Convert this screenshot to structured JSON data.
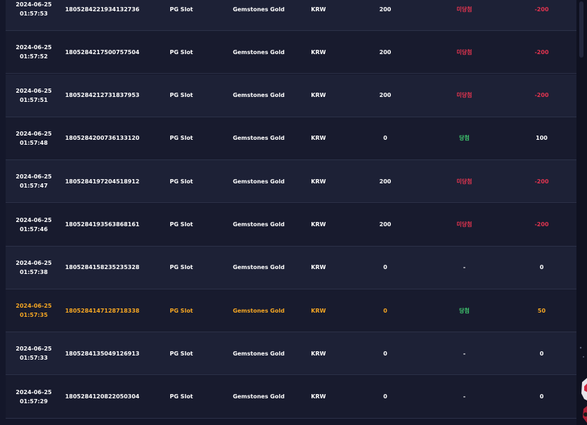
{
  "rows": [
    {
      "date": "2024-06-25",
      "time": "01:57:53",
      "id": "1805284221934132736",
      "provider": "PG Slot",
      "game": "Gemstones Gold",
      "currency": "KRW",
      "bet": "200",
      "result": "미당첨",
      "result_type": "lose",
      "pl": "-200",
      "highlight": false
    },
    {
      "date": "2024-06-25",
      "time": "01:57:52",
      "id": "1805284217500757504",
      "provider": "PG Slot",
      "game": "Gemstones Gold",
      "currency": "KRW",
      "bet": "200",
      "result": "미당첨",
      "result_type": "lose",
      "pl": "-200",
      "highlight": false
    },
    {
      "date": "2024-06-25",
      "time": "01:57:51",
      "id": "1805284212731837953",
      "provider": "PG Slot",
      "game": "Gemstones Gold",
      "currency": "KRW",
      "bet": "200",
      "result": "미당첨",
      "result_type": "lose",
      "pl": "-200",
      "highlight": false
    },
    {
      "date": "2024-06-25",
      "time": "01:57:48",
      "id": "1805284200736133120",
      "provider": "PG Slot",
      "game": "Gemstones Gold",
      "currency": "KRW",
      "bet": "0",
      "result": "당첨",
      "result_type": "win",
      "pl": "100",
      "highlight": false
    },
    {
      "date": "2024-06-25",
      "time": "01:57:47",
      "id": "1805284197204518912",
      "provider": "PG Slot",
      "game": "Gemstones Gold",
      "currency": "KRW",
      "bet": "200",
      "result": "미당첨",
      "result_type": "lose",
      "pl": "-200",
      "highlight": false
    },
    {
      "date": "2024-06-25",
      "time": "01:57:46",
      "id": "1805284193563868161",
      "provider": "PG Slot",
      "game": "Gemstones Gold",
      "currency": "KRW",
      "bet": "200",
      "result": "미당첨",
      "result_type": "lose",
      "pl": "-200",
      "highlight": false
    },
    {
      "date": "2024-06-25",
      "time": "01:57:38",
      "id": "1805284158235235328",
      "provider": "PG Slot",
      "game": "Gemstones Gold",
      "currency": "KRW",
      "bet": "0",
      "result": "-",
      "result_type": "none",
      "pl": "0",
      "highlight": false
    },
    {
      "date": "2024-06-25",
      "time": "01:57:35",
      "id": "1805284147128718338",
      "provider": "PG Slot",
      "game": "Gemstones Gold",
      "currency": "KRW",
      "bet": "0",
      "result": "당첨",
      "result_type": "win",
      "pl": "50",
      "highlight": true
    },
    {
      "date": "2024-06-25",
      "time": "01:57:33",
      "id": "1805284135049126913",
      "provider": "PG Slot",
      "game": "Gemstones Gold",
      "currency": "KRW",
      "bet": "0",
      "result": "-",
      "result_type": "none",
      "pl": "0",
      "highlight": false
    },
    {
      "date": "2024-06-25",
      "time": "01:57:29",
      "id": "1805284120822050304",
      "provider": "PG Slot",
      "game": "Gemstones Gold",
      "currency": "KRW",
      "bet": "0",
      "result": "-",
      "result_type": "none",
      "pl": "0",
      "highlight": false
    }
  ],
  "colors": {
    "lose": "#e2344f",
    "win": "#3ec46d",
    "highlight": "#f5a623",
    "background": "#14172a"
  }
}
